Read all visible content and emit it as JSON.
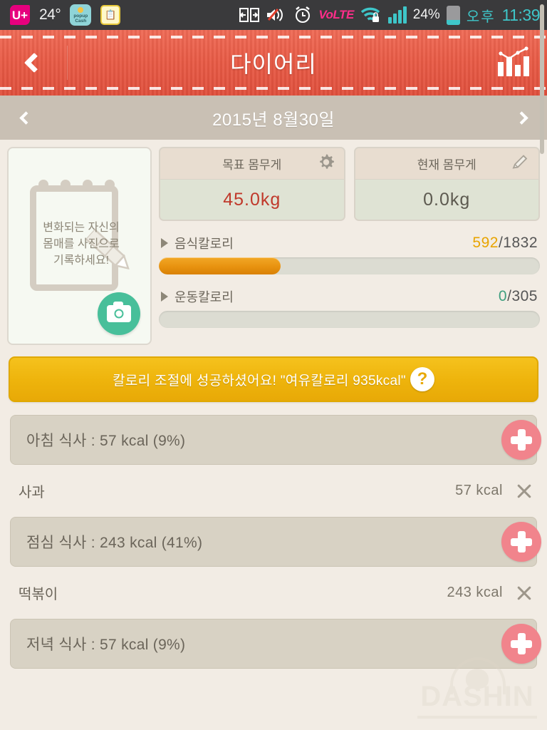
{
  "statusbar": {
    "carrier_logo": "U+",
    "temperature": "24°",
    "popup_cash_label_1": "popup",
    "popup_cash_label_2": "Cash",
    "note_icon": "note-icon",
    "data_icon": "data-transfer-icon",
    "mute_icon": "mute-speaker-icon",
    "alarm_icon": "alarm-clock-icon",
    "volte": "VoLTE",
    "wifi_icon": "wifi-lock-icon",
    "signal_icon": "signal-bars-icon",
    "battery_percent": "24%",
    "battery_icon": "battery-icon",
    "ampm": "오후",
    "time": "11:39"
  },
  "header": {
    "back_icon": "back-chevron-icon",
    "title": "다이어리",
    "chart_icon": "bar-chart-icon"
  },
  "datebar": {
    "prev_icon": "chevron-left-icon",
    "date": "2015년  8월30일",
    "next_icon": "chevron-right-icon"
  },
  "photo_card": {
    "prompt_line1": "변화되는 자신의",
    "prompt_line2": "몸매를 사진으로",
    "prompt_line3": "기록하세요!",
    "camera_icon": "camera-icon",
    "pencil_icon": "pencil-icon"
  },
  "weight": {
    "target": {
      "label": "목표 몸무게",
      "value": "45.0kg",
      "icon": "gear-icon",
      "color": "#c0392b"
    },
    "current": {
      "label": "현재 몸무게",
      "value": "0.0kg",
      "icon": "pencil-icon",
      "color": "#5d5a50"
    }
  },
  "calories": {
    "food": {
      "label": "음식칼로리",
      "current": "592",
      "separator": "/",
      "goal": "1832",
      "percent": 32,
      "accent": "#e8a400"
    },
    "exercise": {
      "label": "운동칼로리",
      "current": "0",
      "separator": "/",
      "goal": "305",
      "percent": 0,
      "accent": "#3f9f7f"
    }
  },
  "banner": {
    "text": "칼로리 조절에 성공하셨어요! \"여유칼로리 935kcal\"",
    "help_label": "?",
    "bg_color": "#eeb40c"
  },
  "meals": [
    {
      "header": "아침 식사 : 57 kcal (9%)",
      "add_label": "add-food",
      "items": [
        {
          "name": "사과",
          "kcal": "57 kcal",
          "remove": "remove-item"
        }
      ]
    },
    {
      "header": "점심 식사 : 243 kcal (41%)",
      "add_label": "add-food",
      "items": [
        {
          "name": "떡볶이",
          "kcal": "243 kcal",
          "remove": "remove-item"
        }
      ]
    },
    {
      "header": "저녁 식사 : 57 kcal (9%)",
      "add_label": "add-food",
      "items": []
    }
  ],
  "watermark": {
    "text": "DASHIN"
  }
}
